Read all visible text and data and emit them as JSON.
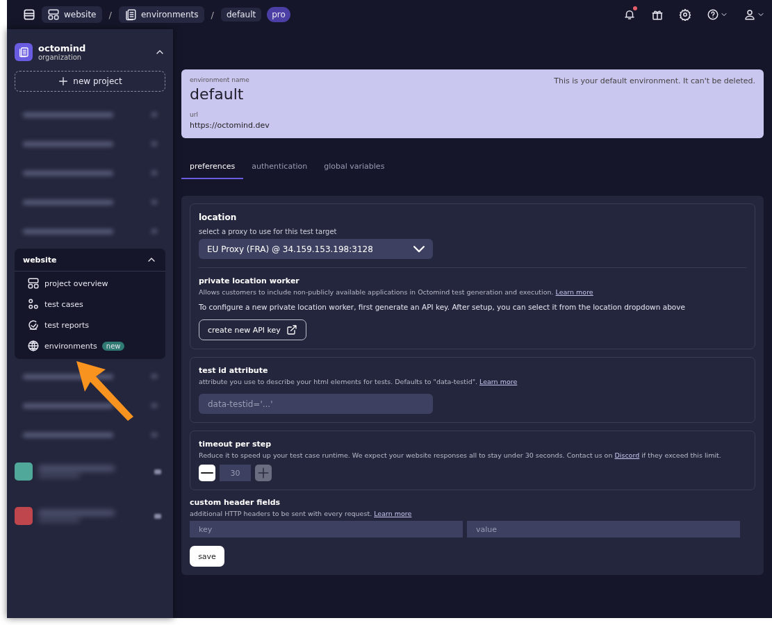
{
  "breadcrumbs": [
    {
      "label": "website",
      "kind": "project"
    },
    {
      "label": "/",
      "kind": "separator"
    },
    {
      "label": "environments",
      "kind": "environments"
    },
    {
      "label": "/",
      "kind": "separator"
    },
    {
      "label": "default",
      "kind": "plain"
    }
  ],
  "plan_badge": "pro",
  "notifications": {
    "unread": true
  },
  "organization": {
    "name": "octomind",
    "subtitle": "organization",
    "expanded": true
  },
  "new_project_button": "new project",
  "blurred_before": [
    {
      "kind": "project"
    },
    {
      "kind": "project"
    },
    {
      "kind": "project"
    },
    {
      "kind": "project"
    },
    {
      "kind": "project"
    }
  ],
  "project": {
    "name": "website",
    "expanded": true,
    "items": [
      {
        "label": "project overview",
        "selected": false
      },
      {
        "label": "test cases",
        "selected": false
      },
      {
        "label": "test reports",
        "selected": false
      },
      {
        "label": "environments",
        "badge": "new",
        "selected": false
      }
    ]
  },
  "blurred_after": [
    {
      "kind": "project"
    },
    {
      "kind": "project"
    },
    {
      "kind": "project"
    },
    {
      "kind": "organization",
      "color": "#4fa89a"
    },
    {
      "kind": "organization",
      "color": "#c0464d"
    }
  ],
  "environment": {
    "name_label": "environment name",
    "name": "default",
    "url_label": "url",
    "url": "https://octomind.dev",
    "note": "This is your default environment. It can't be deleted."
  },
  "tabs": [
    {
      "label": "preferences",
      "selected": true
    },
    {
      "label": "authentication",
      "selected": false
    },
    {
      "label": "global variables",
      "selected": false
    }
  ],
  "location": {
    "title": "location",
    "proxy_label": "select a proxy to use for this test target",
    "proxy_value": "EU Proxy (FRA) @ 34.159.153.198:3128",
    "worker_title": "private location worker",
    "worker_description": "Allows customers to include non-publicly available applications in Octomind test generation and execution.",
    "worker_link": "Learn more",
    "worker_instructions": "To configure a new private location worker, first generate an API key. After setup, you can select it from the location dropdown above",
    "button": "create new API key"
  },
  "test_id": {
    "title": "test id attribute",
    "description": "attribute you use to describe your html elements for tests. Defaults to \"data-testid\".",
    "link": "Learn more",
    "placeholder": "data-testid='...'"
  },
  "timeout": {
    "title": "timeout per step",
    "description_before": "Reduce it to speed up your test case runtime. We expect your website responses all to stay under 30 seconds. Contact us on",
    "link": "Discord",
    "description_after": "if they exceed this limit.",
    "value": "30",
    "decrease_disabled": false,
    "increase_disabled": true
  },
  "custom_headers": {
    "title": "custom header fields",
    "description": "additional HTTP headers to be sent with every request.",
    "link": "Learn more",
    "key_placeholder": "key",
    "value_placeholder": "value"
  },
  "save_button": "save"
}
